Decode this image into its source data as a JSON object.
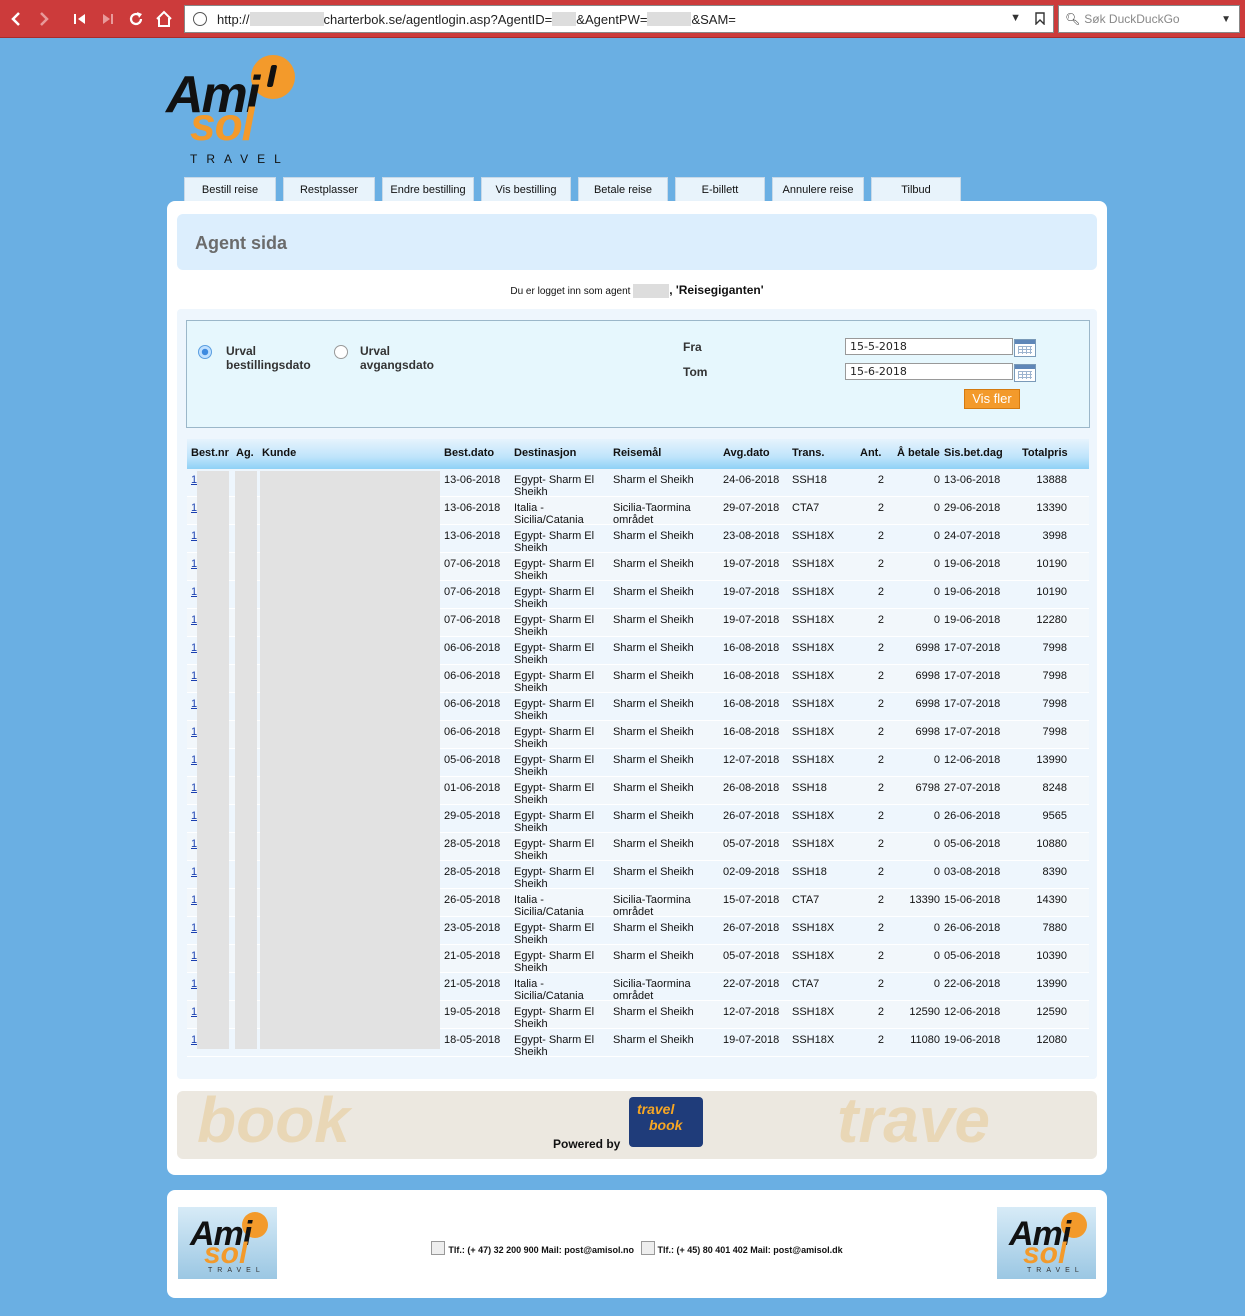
{
  "browser": {
    "url_prefix": "http://",
    "url_main": "charterbok.se/agentlogin.asp?AgentID=",
    "url_pw": "&AgentPW=",
    "url_sam": "&SAM=",
    "search_placeholder": "Søk DuckDuckGo"
  },
  "logo": {
    "ami": "Ami",
    "sol": "sol",
    "travel": "TRAVEL"
  },
  "tabs": [
    "Bestill reise",
    "Restplasser",
    "Endre bestilling",
    "Vis bestilling",
    "Betale reise",
    "E-billett",
    "Annulere reise",
    "Tilbud"
  ],
  "page_title": "Agent sida",
  "login": {
    "prefix": "Du er logget inn som agent",
    "name": ", 'Reisegiganten'"
  },
  "filter": {
    "radio1_line1": "Urval",
    "radio1_line2": "bestillingsdato",
    "radio2_line1": "Urval",
    "radio2_line2": "avgangsdato",
    "fra_label": "Fra",
    "fra_value": "15-5-2018",
    "tom_label": "Tom",
    "tom_value": "15-6-2018",
    "submit": "Vis fler"
  },
  "table": {
    "headers": [
      "Best.nr",
      "Ag.",
      "Kunde",
      "Best.dato",
      "Destinasjon",
      "Reisemål",
      "Avg.dato",
      "Trans.",
      "Ant.",
      "Å betale",
      "Sis.bet.dag",
      "Totalpris"
    ],
    "rows": [
      {
        "bestnr": "1",
        "bestdato": "13-06-2018",
        "dest1": "Egypt- Sharm El",
        "dest2": "Sheikh",
        "mal1": "Sharm el Sheikh",
        "mal2": "",
        "avg": "24-06-2018",
        "trans": "SSH18",
        "ant": "2",
        "betale": "0",
        "sisbet": "13-06-2018",
        "total": "13888"
      },
      {
        "bestnr": "1",
        "bestdato": "13-06-2018",
        "dest1": "Italia -",
        "dest2": "Sicilia/Catania",
        "mal1": "Sicilia-Taormina",
        "mal2": "området",
        "avg": "29-07-2018",
        "trans": "CTA7",
        "ant": "2",
        "betale": "0",
        "sisbet": "29-06-2018",
        "total": "13390"
      },
      {
        "bestnr": "1",
        "bestdato": "13-06-2018",
        "dest1": "Egypt- Sharm El",
        "dest2": "Sheikh",
        "mal1": "Sharm el Sheikh",
        "mal2": "",
        "avg": "23-08-2018",
        "trans": "SSH18X",
        "ant": "2",
        "betale": "0",
        "sisbet": "24-07-2018",
        "total": "3998"
      },
      {
        "bestnr": "1",
        "bestdato": "07-06-2018",
        "dest1": "Egypt- Sharm El",
        "dest2": "Sheikh",
        "mal1": "Sharm el Sheikh",
        "mal2": "",
        "avg": "19-07-2018",
        "trans": "SSH18X",
        "ant": "2",
        "betale": "0",
        "sisbet": "19-06-2018",
        "total": "10190"
      },
      {
        "bestnr": "1",
        "bestdato": "07-06-2018",
        "dest1": "Egypt- Sharm El",
        "dest2": "Sheikh",
        "mal1": "Sharm el Sheikh",
        "mal2": "",
        "avg": "19-07-2018",
        "trans": "SSH18X",
        "ant": "2",
        "betale": "0",
        "sisbet": "19-06-2018",
        "total": "10190"
      },
      {
        "bestnr": "1",
        "bestdato": "07-06-2018",
        "dest1": "Egypt- Sharm El",
        "dest2": "Sheikh",
        "mal1": "Sharm el Sheikh",
        "mal2": "",
        "avg": "19-07-2018",
        "trans": "SSH18X",
        "ant": "2",
        "betale": "0",
        "sisbet": "19-06-2018",
        "total": "12280"
      },
      {
        "bestnr": "1",
        "bestdato": "06-06-2018",
        "dest1": "Egypt- Sharm El",
        "dest2": "Sheikh",
        "mal1": "Sharm el Sheikh",
        "mal2": "",
        "avg": "16-08-2018",
        "trans": "SSH18X",
        "ant": "2",
        "betale": "6998",
        "sisbet": "17-07-2018",
        "total": "7998"
      },
      {
        "bestnr": "1",
        "bestdato": "06-06-2018",
        "dest1": "Egypt- Sharm El",
        "dest2": "Sheikh",
        "mal1": "Sharm el Sheikh",
        "mal2": "",
        "avg": "16-08-2018",
        "trans": "SSH18X",
        "ant": "2",
        "betale": "6998",
        "sisbet": "17-07-2018",
        "total": "7998"
      },
      {
        "bestnr": "1",
        "bestdato": "06-06-2018",
        "dest1": "Egypt- Sharm El",
        "dest2": "Sheikh",
        "mal1": "Sharm el Sheikh",
        "mal2": "",
        "avg": "16-08-2018",
        "trans": "SSH18X",
        "ant": "2",
        "betale": "6998",
        "sisbet": "17-07-2018",
        "total": "7998"
      },
      {
        "bestnr": "1",
        "bestdato": "06-06-2018",
        "dest1": "Egypt- Sharm El",
        "dest2": "Sheikh",
        "mal1": "Sharm el Sheikh",
        "mal2": "",
        "avg": "16-08-2018",
        "trans": "SSH18X",
        "ant": "2",
        "betale": "6998",
        "sisbet": "17-07-2018",
        "total": "7998"
      },
      {
        "bestnr": "1",
        "bestdato": "05-06-2018",
        "dest1": "Egypt- Sharm El",
        "dest2": "Sheikh",
        "mal1": "Sharm el Sheikh",
        "mal2": "",
        "avg": "12-07-2018",
        "trans": "SSH18X",
        "ant": "2",
        "betale": "0",
        "sisbet": "12-06-2018",
        "total": "13990"
      },
      {
        "bestnr": "1",
        "bestdato": "01-06-2018",
        "dest1": "Egypt- Sharm El",
        "dest2": "Sheikh",
        "mal1": "Sharm el Sheikh",
        "mal2": "",
        "avg": "26-08-2018",
        "trans": "SSH18",
        "ant": "2",
        "betale": "6798",
        "sisbet": "27-07-2018",
        "total": "8248"
      },
      {
        "bestnr": "1",
        "bestdato": "29-05-2018",
        "dest1": "Egypt- Sharm El",
        "dest2": "Sheikh",
        "mal1": "Sharm el Sheikh",
        "mal2": "",
        "avg": "26-07-2018",
        "trans": "SSH18X",
        "ant": "2",
        "betale": "0",
        "sisbet": "26-06-2018",
        "total": "9565"
      },
      {
        "bestnr": "1",
        "bestdato": "28-05-2018",
        "dest1": "Egypt- Sharm El",
        "dest2": "Sheikh",
        "mal1": "Sharm el Sheikh",
        "mal2": "",
        "avg": "05-07-2018",
        "trans": "SSH18X",
        "ant": "2",
        "betale": "0",
        "sisbet": "05-06-2018",
        "total": "10880"
      },
      {
        "bestnr": "1",
        "bestdato": "28-05-2018",
        "dest1": "Egypt- Sharm El",
        "dest2": "Sheikh",
        "mal1": "Sharm el Sheikh",
        "mal2": "",
        "avg": "02-09-2018",
        "trans": "SSH18",
        "ant": "2",
        "betale": "0",
        "sisbet": "03-08-2018",
        "total": "8390"
      },
      {
        "bestnr": "1",
        "bestdato": "26-05-2018",
        "dest1": "Italia -",
        "dest2": "Sicilia/Catania",
        "mal1": "Sicilia-Taormina",
        "mal2": "området",
        "avg": "15-07-2018",
        "trans": "CTA7",
        "ant": "2",
        "betale": "13390",
        "sisbet": "15-06-2018",
        "total": "14390"
      },
      {
        "bestnr": "1",
        "bestdato": "23-05-2018",
        "dest1": "Egypt- Sharm El",
        "dest2": "Sheikh",
        "mal1": "Sharm el Sheikh",
        "mal2": "",
        "avg": "26-07-2018",
        "trans": "SSH18X",
        "ant": "2",
        "betale": "0",
        "sisbet": "26-06-2018",
        "total": "7880"
      },
      {
        "bestnr": "1",
        "bestdato": "21-05-2018",
        "dest1": "Egypt- Sharm El",
        "dest2": "Sheikh",
        "mal1": "Sharm el Sheikh",
        "mal2": "",
        "avg": "05-07-2018",
        "trans": "SSH18X",
        "ant": "2",
        "betale": "0",
        "sisbet": "05-06-2018",
        "total": "10390"
      },
      {
        "bestnr": "1",
        "bestdato": "21-05-2018",
        "dest1": "Italia -",
        "dest2": "Sicilia/Catania",
        "mal1": "Sicilia-Taormina",
        "mal2": "området",
        "avg": "22-07-2018",
        "trans": "CTA7",
        "ant": "2",
        "betale": "0",
        "sisbet": "22-06-2018",
        "total": "13990"
      },
      {
        "bestnr": "1",
        "bestdato": "19-05-2018",
        "dest1": "Egypt- Sharm El",
        "dest2": "Sheikh",
        "mal1": "Sharm el Sheikh",
        "mal2": "",
        "avg": "12-07-2018",
        "trans": "SSH18X",
        "ant": "2",
        "betale": "12590",
        "sisbet": "12-06-2018",
        "total": "12590"
      },
      {
        "bestnr": "1",
        "bestdato": "18-05-2018",
        "dest1": "Egypt- Sharm El",
        "dest2": "Sheikh",
        "mal1": "Sharm el Sheikh",
        "mal2": "",
        "avg": "19-07-2018",
        "trans": "SSH18X",
        "ant": "2",
        "betale": "11080",
        "sisbet": "19-06-2018",
        "total": "12080"
      }
    ]
  },
  "powered": {
    "label": "Powered by",
    "tb_line1": "travel",
    "tb_line2": "book"
  },
  "footer": {
    "contact_no": "Tlf.: (+ 47) 32 200 900 Mail: post@amisol.no",
    "contact_dk": "Tlf.: (+ 45) 80 401 402 Mail: post@amisol.dk"
  }
}
